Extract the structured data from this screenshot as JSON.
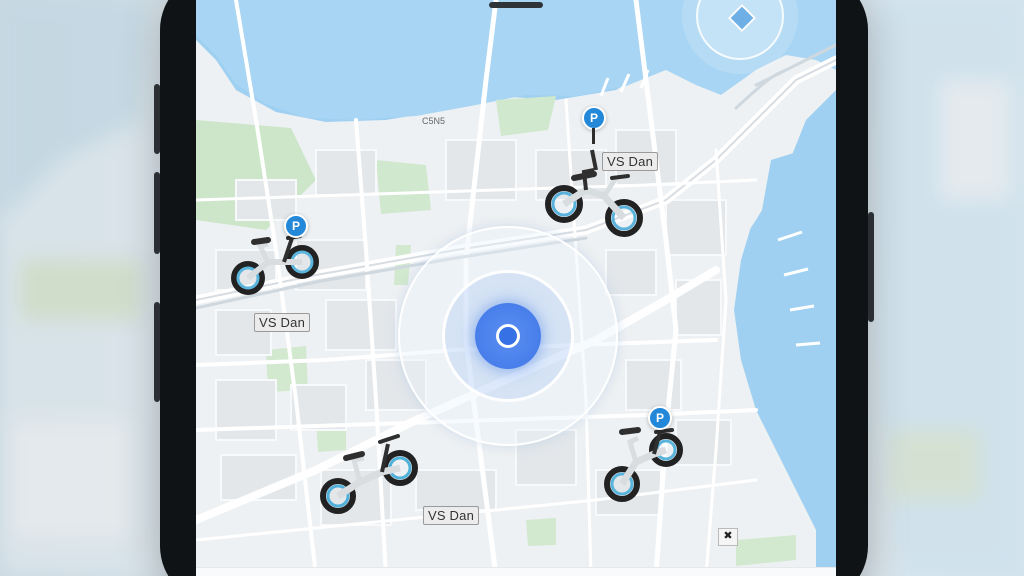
{
  "map": {
    "street_labels": {
      "top": "C5N5",
      "upper_left": "",
      "mid_left": ""
    },
    "place_labels": [
      "VS Dan",
      "VS Dan",
      "VS Dan"
    ],
    "pin_glyph": "P",
    "close_marker": "✖"
  },
  "colors": {
    "water": "#9fd0f1",
    "land": "#eef1f3",
    "park": "#c9e5c6",
    "road": "#ffffff",
    "location_blue": "#3f77e8",
    "pin_blue": "#2388d8"
  },
  "icons": {
    "compass": "compass-icon",
    "location": "current-location-icon",
    "bike": "bike-icon",
    "pin": "bike-station-pin-icon"
  }
}
